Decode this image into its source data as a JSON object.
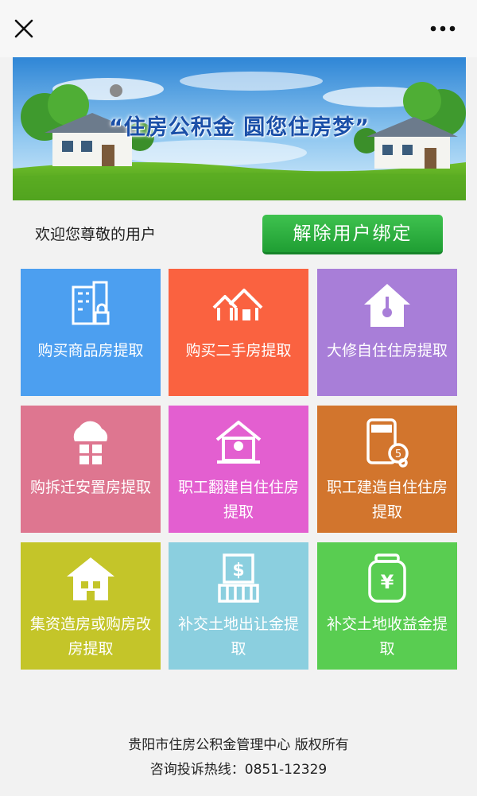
{
  "topbar": {
    "close_icon": "close-icon",
    "more_icon": "more-dots-icon"
  },
  "banner": {
    "slogan": "“住房公积金  圆您住房梦”"
  },
  "welcome_text": "欢迎您尊敬的用户",
  "unbind_label": "解除用户绑定",
  "tiles": [
    {
      "label": "购买商品房提取",
      "color": "#4c9ff0",
      "icon": "building-lock-icon"
    },
    {
      "label": "购买二手房提取",
      "color": "#fa6240",
      "icon": "houses-icon"
    },
    {
      "label": "大修自住住房提取",
      "color": "#a87ed8",
      "icon": "house-repair-icon"
    },
    {
      "label": "购拆迁安置房提取",
      "color": "#de7690",
      "icon": "cloud-window-icon"
    },
    {
      "label": "职工翻建自住住房提取",
      "color": "#e35fd0",
      "icon": "house-rebuild-icon"
    },
    {
      "label": "职工建造自住住房提取",
      "color": "#d2752d",
      "icon": "phone-coin-icon"
    },
    {
      "label": "集资造房或购房改房提取",
      "color": "#c4c529",
      "icon": "house-fund-icon"
    },
    {
      "label": "补交土地出让金提取",
      "color": "#8bcfdf",
      "icon": "receipt-dollar-icon"
    },
    {
      "label": "补交土地收益金提取",
      "color": "#59cd51",
      "icon": "yen-bag-icon"
    }
  ],
  "footer": {
    "copyright": "贵阳市住房公积金管理中心 版权所有",
    "hotline": "咨询投诉热线：0851-12329"
  }
}
